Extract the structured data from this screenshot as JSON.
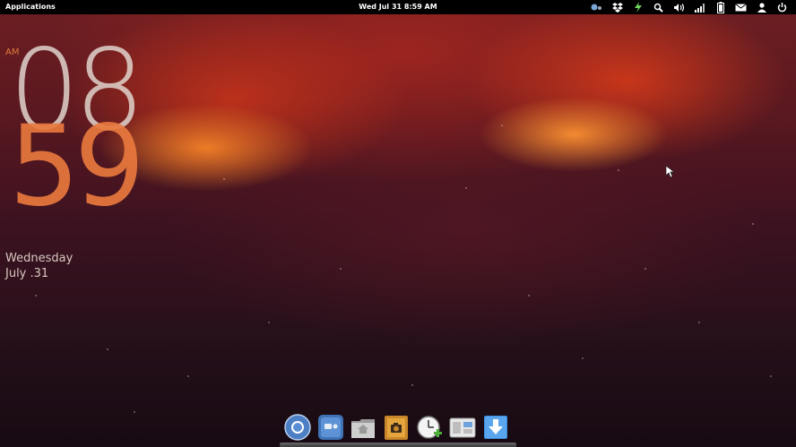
{
  "panel": {
    "applications_label": "Applications",
    "datetime": "Wed Jul 31  8:59 AM",
    "indicators": [
      "bluetooth-icon",
      "dropbox-icon",
      "power-lightning-icon",
      "search-icon",
      "volume-icon",
      "network-signal-icon",
      "battery-icon",
      "mail-icon",
      "user-icon",
      "power-icon"
    ]
  },
  "clock_widget": {
    "ampm": "AM",
    "hours": "08",
    "minutes": "59",
    "day": "Wednesday",
    "date": "July .31"
  },
  "dock": {
    "items": [
      "chromium-browser-icon",
      "photo-viewer-icon",
      "files-home-icon",
      "screenshot-camera-icon",
      "alarm-clock-icon",
      "system-settings-icon",
      "download-manager-icon"
    ]
  },
  "colors": {
    "panel_bg": "#000000",
    "clock_hours": "#e1d4cd",
    "clock_minutes": "#e8783e",
    "date_text": "#d8c8c0"
  }
}
